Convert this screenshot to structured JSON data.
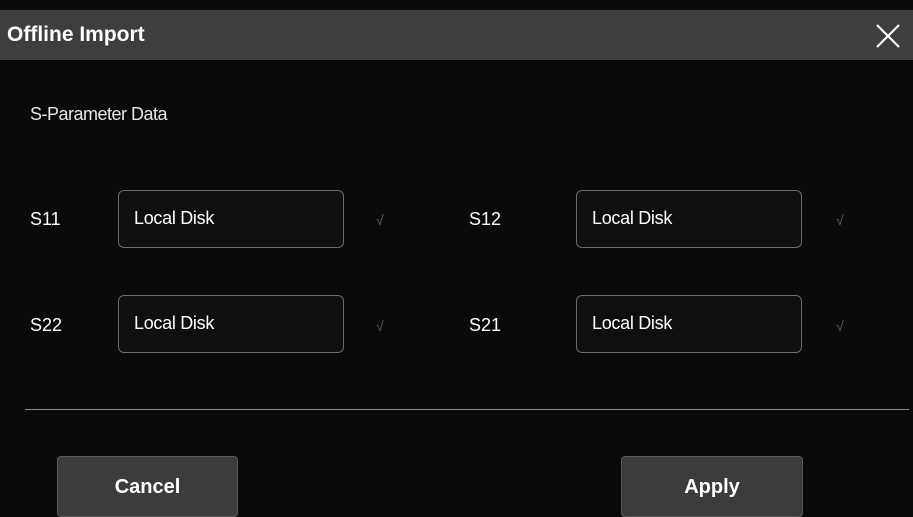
{
  "dialog": {
    "title": "Offline Import",
    "close_icon": "close-x-icon"
  },
  "section": {
    "title": "S-Parameter Data"
  },
  "params": [
    {
      "label": "S11",
      "value": "Local Disk",
      "check": "√"
    },
    {
      "label": "S12",
      "value": "Local Disk",
      "check": "√"
    },
    {
      "label": "S22",
      "value": "Local Disk",
      "check": "√"
    },
    {
      "label": "S21",
      "value": "Local Disk",
      "check": "√"
    }
  ],
  "buttons": {
    "cancel_label": "Cancel",
    "apply_label": "Apply"
  },
  "colors": {
    "background": "#0a0a0a",
    "titlebar": "#3e3e3e",
    "button": "#3c3c3c",
    "field_border": "#6a6a6a"
  }
}
